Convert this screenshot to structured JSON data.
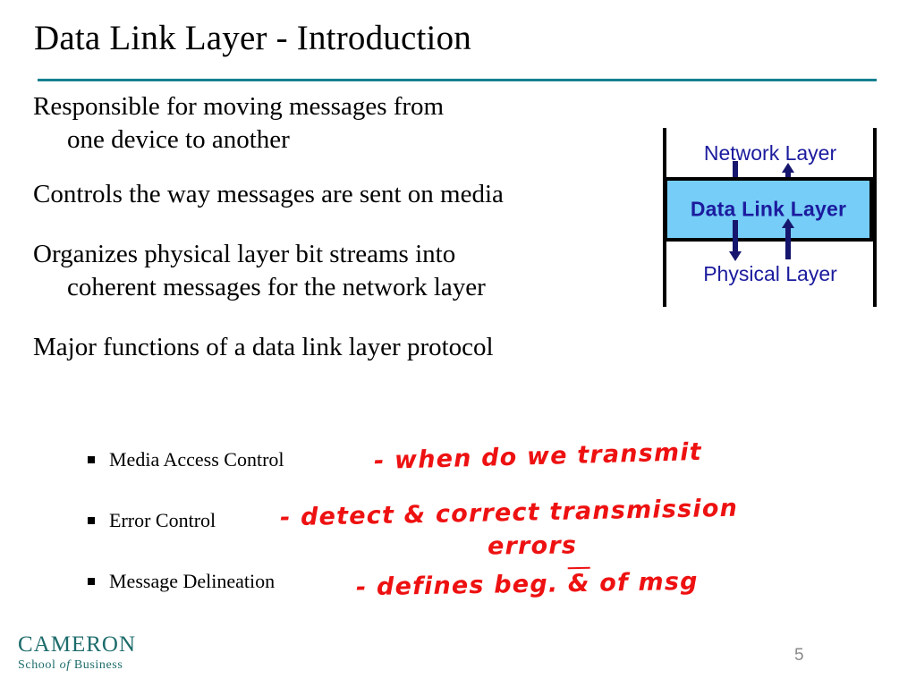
{
  "slide": {
    "title": "Data Link Layer - Introduction",
    "page_number": "5",
    "rule_color": "#15808f"
  },
  "body": {
    "paragraphs": [
      {
        "line1": "Responsible for moving messages from",
        "line2": "one device to another"
      },
      {
        "line1": "Controls the way messages are sent on media",
        "line2": ""
      },
      {
        "line1": "Organizes physical layer bit streams into",
        "line2": "coherent messages for the network layer"
      },
      {
        "line1": "Major functions of a data link layer protocol",
        "line2": ""
      }
    ],
    "p0_line1": "Responsible for moving messages from",
    "p0_line2": "one device to another",
    "p1_line1": "Controls the way messages are sent on media",
    "p2_line1": "Organizes physical layer bit streams into",
    "p2_line2": "coherent messages for the network layer",
    "p3_line1": "Major functions of a data link layer protocol"
  },
  "bullets": {
    "items": [
      {
        "label": "Media Access Control"
      },
      {
        "label": "Error Control"
      },
      {
        "label": "Message Delineation"
      }
    ],
    "item0_label": "Media Access Control",
    "item1_label": "Error Control",
    "item2_label": "Message Delineation"
  },
  "annotations": {
    "ink_color": "#ee1111",
    "line1": "- when do we transmit",
    "line2": "- detect & correct transmission",
    "line3": "errors",
    "line4_pre": "- defines  beg.  ",
    "line4_amp": "&",
    "line4_post": "  of  msg"
  },
  "diagram": {
    "top_label": "Network Layer",
    "middle_label": "Data Link Layer",
    "bottom_label": "Physical Layer",
    "box_fill": "#76cdf7",
    "text_color": "#1b1b9e",
    "arrow_color": "#16166e",
    "arrows": [
      {
        "name": "network-to-datalink",
        "direction": "down"
      },
      {
        "name": "datalink-to-network",
        "direction": "up"
      },
      {
        "name": "datalink-to-physical",
        "direction": "down"
      },
      {
        "name": "physical-to-datalink",
        "direction": "up"
      }
    ]
  },
  "footer": {
    "logo_main": "CAMERON",
    "logo_sub_school": "School",
    "logo_sub_of": "of",
    "logo_sub_business": "Business",
    "logo_color": "#1d6b6b"
  }
}
